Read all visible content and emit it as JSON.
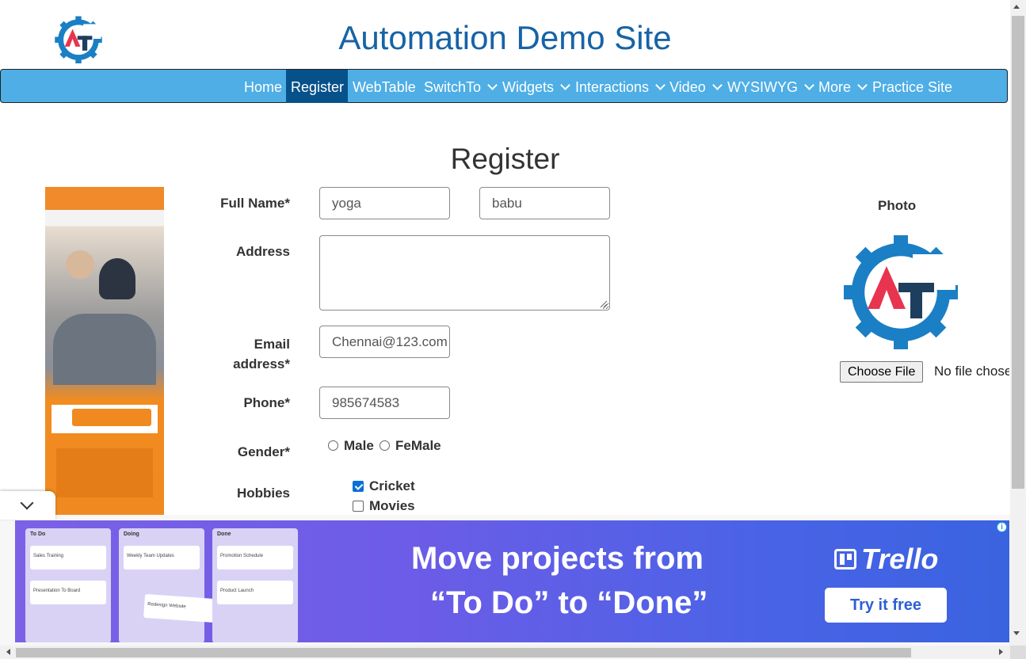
{
  "header": {
    "title": "Automation Demo Site"
  },
  "nav": {
    "items": [
      {
        "label": "Home",
        "dropdown": false
      },
      {
        "label": "Register",
        "dropdown": false,
        "active": true
      },
      {
        "label": "WebTable",
        "dropdown": false
      },
      {
        "label": "SwitchTo",
        "dropdown": true
      },
      {
        "label": "Widgets",
        "dropdown": true
      },
      {
        "label": "Interactions",
        "dropdown": true
      },
      {
        "label": "Video",
        "dropdown": true
      },
      {
        "label": "WYSIWYG",
        "dropdown": true
      },
      {
        "label": "More",
        "dropdown": true
      },
      {
        "label": "Practice Site",
        "dropdown": false
      }
    ]
  },
  "form": {
    "heading": "Register",
    "full_name_label": "Full Name*",
    "first_name_value": "yoga",
    "last_name_value": "babu",
    "address_label": "Address",
    "address_value": "",
    "email_label_line1": "Email",
    "email_label_line2": "address*",
    "email_value": "Chennai@123.com",
    "phone_label": "Phone*",
    "phone_value": "985674583",
    "gender_label": "Gender*",
    "gender_options": [
      "Male",
      "FeMale"
    ],
    "hobbies_label": "Hobbies",
    "hobbies": [
      {
        "label": "Cricket",
        "checked": true
      },
      {
        "label": "Movies",
        "checked": false
      }
    ]
  },
  "photo": {
    "label": "Photo",
    "choose_file_label": "Choose File",
    "no_file_text": "No file chosen"
  },
  "bottom_ad": {
    "boards": [
      {
        "title": "To Do",
        "cards": [
          "Sales Training",
          "Presentation To Board"
        ]
      },
      {
        "title": "Doing",
        "cards": [
          "Weekly Team Updates",
          "Redesign Website"
        ]
      },
      {
        "title": "Done",
        "cards": [
          "Promotion Schedule",
          "Product Launch"
        ]
      }
    ],
    "headline_1": "Move projects from",
    "headline_2": "“To Do” to “Done”",
    "brand": "Trello",
    "cta": "Try it free",
    "info_icon": "i"
  },
  "colors": {
    "title_blue": "#1763a6",
    "nav_bg": "#4eaee5",
    "nav_active": "#07518a"
  }
}
